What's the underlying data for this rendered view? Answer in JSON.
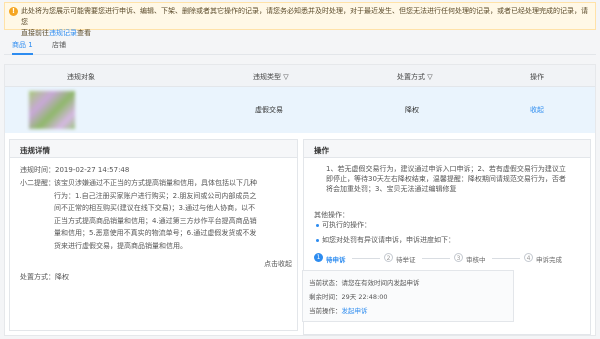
{
  "notice": {
    "icon": "warning-icon",
    "line1": "此处将为您展示可能需要您进行申诉、编辑、下架、删除或者其它操作的记录，请您务必知悉并及时处理，对于最近发生、但您无法进行任何处理的记录，或者已经处理完成的记录，请您",
    "line2_prefix": "直接前往",
    "link": "违规记录",
    "line2_suffix": "查看"
  },
  "tabs": [
    {
      "label": "商品 1"
    },
    {
      "label": "店铺"
    }
  ],
  "table": {
    "headers": {
      "object": "违规对象",
      "type": "违规类型",
      "handle": "处置方式",
      "action": "操作"
    },
    "filter_icon": "▽",
    "row": {
      "type": "虚假交易",
      "handle": "降权",
      "action": "收起"
    }
  },
  "detail": {
    "title": "违规详情",
    "time_label": "违规时间：",
    "time_value": "2019-02-27 14:57:48",
    "tip_label": "小二提醒：",
    "tip_lines": [
      "该宝贝涉嫌通过不正当的方式提高销量和信用，具体包括以下几种",
      "行为：1.自己注册买家账户进行购买；2.朋友间或公司内部成员之",
      "间不正常的相互购买(建议在线下交易)；3.通过与他人协商，以不",
      "正当方式提高商品销量和信用；4.通过第三方炒作平台提高商品销",
      "量和信用；5.恶意使用不真实的物流单号；6.通过虚假发货或不发",
      "货来进行虚假交易，提高商品销量和信用。"
    ],
    "collapse_link": "点击收起",
    "handle_label": "处置方式：",
    "handle_value": "降权"
  },
  "operation": {
    "title": "操作",
    "lines": [
      "1、若无虚假交易行为，建议通过申诉入口申诉；2、若有虚假交易行为建议立",
      "即停止，等待30天左右降权结束，温馨提醒：降权期间请规范交易行为，否者",
      "将会加重处罚；3、宝贝无法通过编辑修复"
    ],
    "other_label": "其他操作：",
    "other_item": "可执行的操作：",
    "appeal_line": "如您对处罚有异议请申诉，申诉进度如下：",
    "steps": [
      {
        "num": "1",
        "label": "待申诉"
      },
      {
        "num": "2",
        "label": "待举证"
      },
      {
        "num": "3",
        "label": "审核中"
      },
      {
        "num": "4",
        "label": "申诉完成"
      }
    ],
    "status_label": "当前状态：",
    "status_value": "请您在有效时间内发起申诉",
    "remaining_label": "剩余时间：",
    "remaining_value": "29天 22:48:00",
    "action_label": "当前操作：",
    "action_link": "发起申诉"
  },
  "colors": {
    "accent": "#2d8cf0",
    "notice_bg": "#fff8e6",
    "row_highlight": "#eaf4fd"
  }
}
